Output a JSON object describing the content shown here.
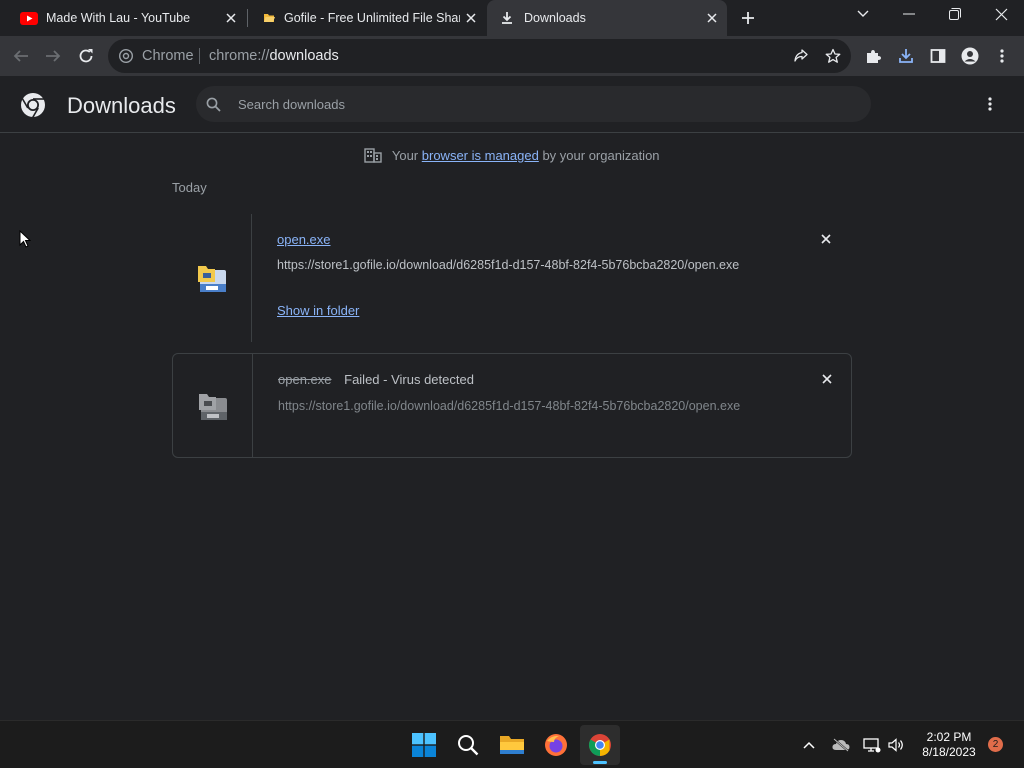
{
  "browser": {
    "tabs": [
      {
        "title": "Made With Lau - YouTube",
        "active": false
      },
      {
        "title": "Gofile - Free Unlimited File Sharing",
        "active": false
      },
      {
        "title": "Downloads",
        "active": true
      }
    ],
    "omnibox": {
      "chip": "Chrome",
      "url_scheme": "chrome://",
      "url_host": "downloads"
    }
  },
  "page": {
    "title": "Downloads",
    "search": {
      "placeholder": "Search downloads",
      "value": ""
    },
    "managed": {
      "prefix": "Your",
      "link": "browser is managed",
      "suffix": "by your organization"
    },
    "date_label": "Today",
    "downloads": [
      {
        "name": "open.exe",
        "url": "https://store1.gofile.io/download/d6285f1d-d157-48bf-82f4-5b76bcba2820/open.exe",
        "action": "Show in folder",
        "status": ""
      },
      {
        "name": "open.exe",
        "url": "https://store1.gofile.io/download/d6285f1d-d157-48bf-82f4-5b76bcba2820/open.exe",
        "action": "",
        "status": "Failed - Virus detected"
      }
    ]
  },
  "taskbar": {
    "time": "2:02 PM",
    "date": "8/18/2023",
    "notifications": "2",
    "apps": [
      "windows-start",
      "search",
      "file-explorer",
      "firefox",
      "chrome"
    ]
  },
  "colors": {
    "background": "#202124",
    "toolbar": "#35363a",
    "link": "#8ab4f8",
    "text": "#e8eaed",
    "muted": "#9aa0a6"
  }
}
